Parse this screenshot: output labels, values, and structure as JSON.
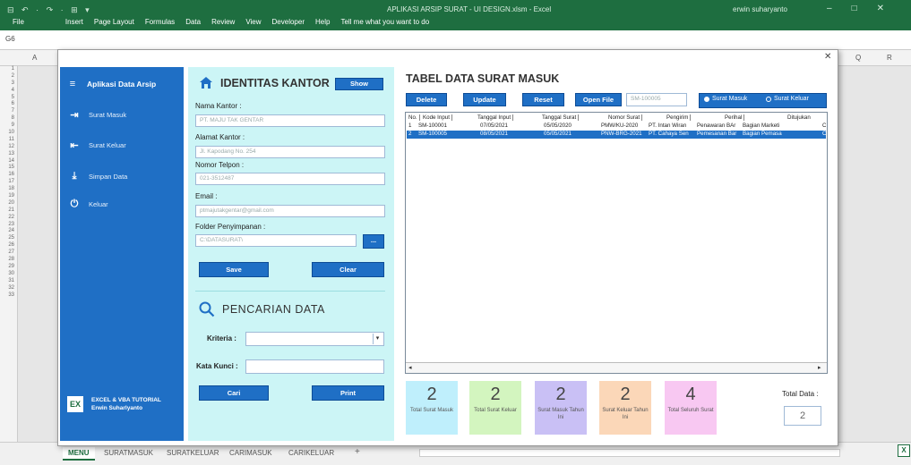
{
  "excel": {
    "window_title": "APLIKASI ARSIP SURAT - UI DESIGN.xlsm  -  Excel",
    "user": "erwin suharyanto",
    "quick_access": "⊟ ↶ · ↷ · ⊞ ▾",
    "name_box": "G6",
    "menus": [
      "File",
      "Insert",
      "Page Layout",
      "Formulas",
      "Data",
      "Review",
      "View",
      "Developer",
      "Help",
      "Tell me what you want to do"
    ],
    "columns": [
      "A",
      "Q",
      "R"
    ],
    "rows": [
      "1",
      "2",
      "3",
      "4",
      "5",
      "6",
      "7",
      "8",
      "9",
      "10",
      "11",
      "12",
      "13",
      "14",
      "15",
      "16",
      "17",
      "18",
      "19",
      "20",
      "21",
      "22",
      "23",
      "24",
      "25",
      "26",
      "27",
      "28",
      "29",
      "30",
      "31",
      "32",
      "33"
    ],
    "sheet_tabs": [
      "MENU",
      "SURATMASUK",
      "SURATKELUAR",
      "CARIMASUK",
      "CARIKELUAR"
    ],
    "add_sheet": "+",
    "excel_logo": "X"
  },
  "sidebar": {
    "title": "Aplikasi Data Arsip",
    "items": [
      {
        "label": "Surat Masuk",
        "icon": "arrow-in-icon"
      },
      {
        "label": "Surat Keluar",
        "icon": "arrow-out-icon"
      },
      {
        "label": "Simpan Data",
        "icon": "download-icon"
      },
      {
        "label": "Keluar",
        "icon": "power-icon"
      }
    ],
    "footer_line1": "EXCEL & VBA TUTORIAL",
    "footer_line2": "Erwin Suharlyanto",
    "footer_logo": "EX"
  },
  "identitas": {
    "title": "IDENTITAS KANTOR",
    "show_label": "Show",
    "nama_label": "Nama Kantor :",
    "nama_value": "PT. MAJU TAK GENTAR",
    "alamat_label": "Alamat Kantor :",
    "alamat_value": "Jl. Kapodang No. 254",
    "telp_label": "Nomor Telpon :",
    "telp_value": "021-3512487",
    "email_label": "Email :",
    "email_value": "ptmajutakgentar@gmail.com",
    "folder_label": "Folder Penyimpanan :",
    "folder_value": "C:\\DATASURAT\\",
    "browse_label": "...",
    "save_label": "Save",
    "clear_label": "Clear"
  },
  "pencarian": {
    "title": "PENCARIAN DATA",
    "kriteria_label": "Kriteria :",
    "kata_kunci_label": "Kata Kunci :",
    "cari_label": "Cari",
    "print_label": "Print"
  },
  "tabel": {
    "title": "TABEL DATA SURAT MASUK",
    "delete_label": "Delete",
    "update_label": "Update",
    "reset_label": "Reset",
    "open_file_label": "Open File",
    "id_value": "SM-100005",
    "option_masuk": "Surat Masuk",
    "option_keluar": "Surat Keluar",
    "headers": [
      "No.",
      "Kode Input",
      "Tanggal Input",
      "Tanggal Surat",
      "Nomor Surat",
      "Pengirim",
      "Perihal",
      "Ditujukan"
    ],
    "rows": [
      [
        "1",
        "SM-100001",
        "07/05/2021",
        "05/05/2020",
        "PMW/KU-2020",
        "PT. Intan Wiran",
        "Penawaran BAr",
        "Bagian Marketi",
        "C"
      ],
      [
        "2",
        "SM-100005",
        "08/05/2021",
        "05/05/2021",
        "PNW-BRG-2021",
        "PT. Cahaya Sen",
        "Pemesanan Bar",
        "Bagian Pemasa",
        "C"
      ]
    ],
    "scroll_left": "◂",
    "scroll_right": "▸"
  },
  "stats": [
    {
      "value": "2",
      "caption": "Total Surat Masuk",
      "color": "#bfeffc"
    },
    {
      "value": "2",
      "caption": "Total Surat Keluar",
      "color": "#d3f5bf"
    },
    {
      "value": "2",
      "caption": "Surat Masuk Tahun Ini",
      "color": "#c9c0f5"
    },
    {
      "value": "2",
      "caption": "Surat Keluar Tahun Ini",
      "color": "#fbd7b8"
    },
    {
      "value": "4",
      "caption": "Total Seluruh Surat",
      "color": "#f8c8f2"
    }
  ],
  "total": {
    "label": "Total Data :",
    "value": "2"
  },
  "colors": {
    "excel_green": "#1e6e40",
    "sidebar_blue": "#1f6fc5",
    "panel_cyan": "#ccf5f6"
  }
}
